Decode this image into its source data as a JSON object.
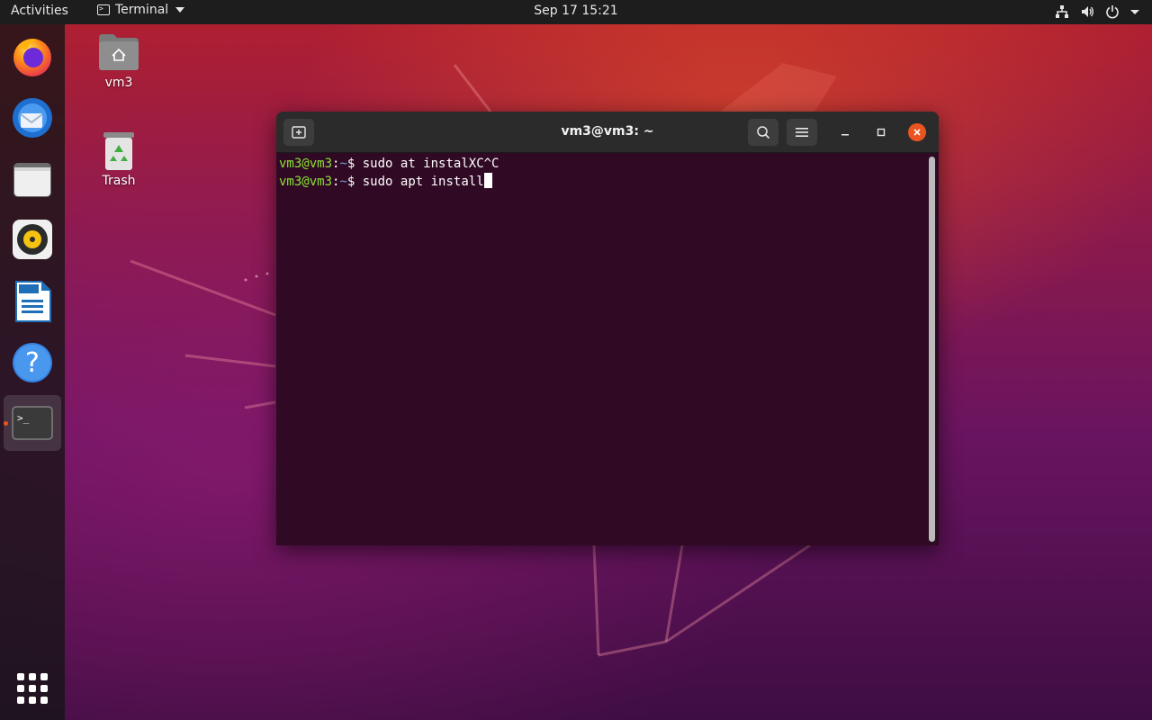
{
  "topbar": {
    "activities": "Activities",
    "app_name": "Terminal",
    "clock": "Sep 17  15:21",
    "tray_icons": [
      "network-icon",
      "volume-icon",
      "power-icon",
      "chevron-down-icon"
    ]
  },
  "dock": {
    "items": [
      {
        "name": "firefox",
        "icon": "firefox-icon"
      },
      {
        "name": "thunderbird",
        "icon": "thunderbird-icon"
      },
      {
        "name": "files",
        "icon": "files-icon"
      },
      {
        "name": "rhythmbox",
        "icon": "rhythmbox-icon"
      },
      {
        "name": "libreoffice-writer",
        "icon": "writer-icon"
      },
      {
        "name": "help",
        "icon": "help-icon"
      },
      {
        "name": "terminal",
        "icon": "terminal-icon",
        "active": true
      }
    ],
    "show_apps_icon": "apps-grid-icon"
  },
  "desktop": {
    "icons": [
      {
        "label": "vm3",
        "icon": "home-folder-icon"
      },
      {
        "label": "Trash",
        "icon": "trash-icon"
      }
    ]
  },
  "window": {
    "title": "vm3@vm3: ~",
    "lines": [
      {
        "user": "vm3@vm3",
        "sep": ":",
        "path": "~",
        "symbol": "$",
        "command": " sudo at instalXC^C"
      },
      {
        "user": "vm3@vm3",
        "sep": ":",
        "path": "~",
        "symbol": "$",
        "command": " sudo apt install"
      }
    ]
  },
  "colors": {
    "accent": "#e95420",
    "terminal_bg": "#300a24",
    "prompt_user": "#8ae234",
    "prompt_path": "#729fcf"
  }
}
